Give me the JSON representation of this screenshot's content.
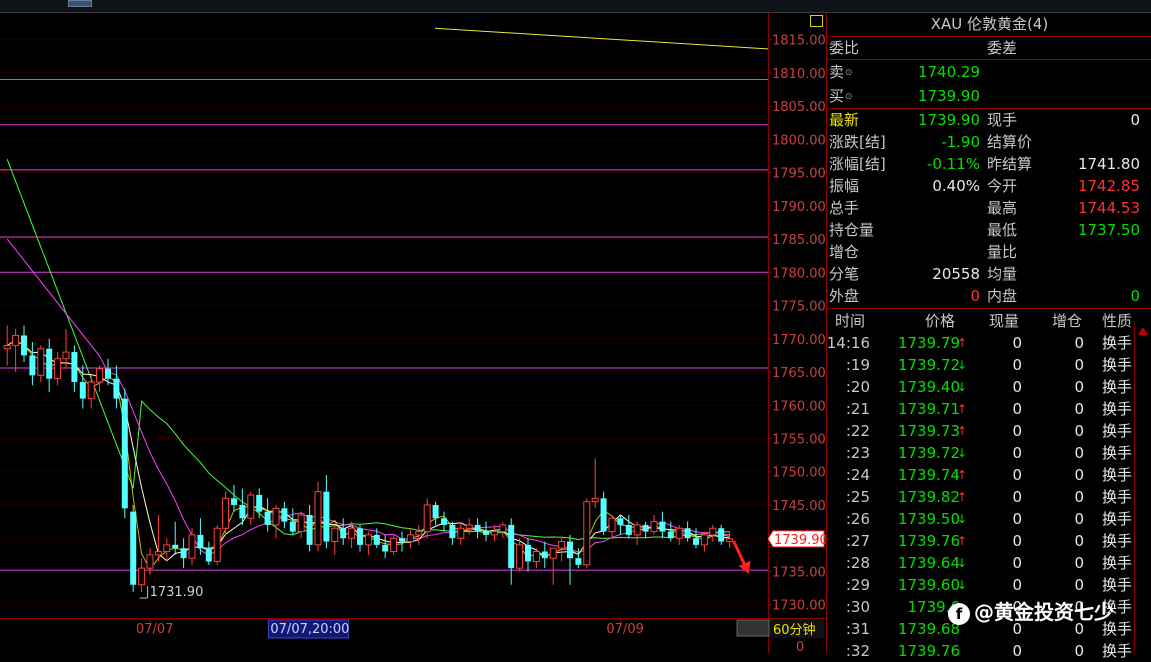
{
  "chart_data": {
    "type": "candlestick",
    "timeframe": "60分钟",
    "ylim": [
      1728.0,
      1819.0
    ],
    "y_ticks": [
      1815,
      1810,
      1805,
      1800,
      1795,
      1790,
      1785,
      1780,
      1775,
      1770,
      1765,
      1760,
      1755,
      1750,
      1745,
      1740,
      1735,
      1730
    ],
    "y_tick_labels": [
      "1815.00",
      "1810.00",
      "1805.00",
      "1800.00",
      "1795.00",
      "1790.00",
      "1785.00",
      "1780.00",
      "1775.00",
      "1770.00",
      "1765.00",
      "1760.00",
      "1755.00",
      "1750.00",
      "1745.00",
      "1740.00",
      "1735.00",
      "1730.00"
    ],
    "x_labels": [
      {
        "text": "07/07",
        "index": 17
      },
      {
        "text": "07/07,20:00",
        "index": 33,
        "highlight": true
      },
      {
        "text": "07/09",
        "index": 73
      }
    ],
    "last_price_label": "1739.90",
    "low_annotation": {
      "text": "1731.90",
      "index": 16,
      "value": 1731.9
    },
    "horizontal_levels": [
      1809.0,
      1802.2,
      1795.4,
      1785.3,
      1780.0,
      1765.6,
      1735.2
    ],
    "candles": [
      [
        1768.5,
        1772.0,
        1766.0,
        1769.0
      ],
      [
        1769.0,
        1771.5,
        1765.0,
        1770.5
      ],
      [
        1770.5,
        1772.0,
        1766.5,
        1767.5
      ],
      [
        1767.5,
        1769.5,
        1763.0,
        1764.5
      ],
      [
        1764.5,
        1769.0,
        1763.5,
        1768.5
      ],
      [
        1768.5,
        1770.0,
        1762.0,
        1764.0
      ],
      [
        1764.0,
        1768.0,
        1763.0,
        1767.0
      ],
      [
        1767.0,
        1771.5,
        1765.5,
        1768.0
      ],
      [
        1768.0,
        1769.0,
        1762.0,
        1763.5
      ],
      [
        1763.5,
        1766.0,
        1759.5,
        1761.0
      ],
      [
        1761.0,
        1764.5,
        1759.5,
        1763.5
      ],
      [
        1763.5,
        1766.0,
        1762.0,
        1765.5
      ],
      [
        1765.5,
        1767.0,
        1763.0,
        1764.0
      ],
      [
        1764.0,
        1766.0,
        1759.5,
        1761.0
      ],
      [
        1761.0,
        1762.5,
        1743.0,
        1744.5
      ],
      [
        1744.0,
        1745.0,
        1731.9,
        1733.0
      ],
      [
        1733.0,
        1737.0,
        1731.9,
        1735.5
      ],
      [
        1735.5,
        1738.5,
        1734.5,
        1737.5
      ],
      [
        1737.5,
        1743.5,
        1736.5,
        1738.0
      ],
      [
        1738.0,
        1740.0,
        1736.5,
        1739.0
      ],
      [
        1739.0,
        1742.5,
        1737.5,
        1738.5
      ],
      [
        1738.5,
        1740.0,
        1735.5,
        1737.0
      ],
      [
        1737.0,
        1741.5,
        1736.0,
        1740.5
      ],
      [
        1740.5,
        1743.0,
        1737.5,
        1738.5
      ],
      [
        1738.5,
        1739.5,
        1736.0,
        1736.5
      ],
      [
        1736.5,
        1742.0,
        1736.0,
        1741.5
      ],
      [
        1741.5,
        1747.0,
        1740.5,
        1746.0
      ],
      [
        1746.0,
        1748.0,
        1744.0,
        1745.0
      ],
      [
        1745.0,
        1747.5,
        1742.0,
        1743.0
      ],
      [
        1743.0,
        1747.0,
        1742.0,
        1746.5
      ],
      [
        1746.5,
        1747.5,
        1743.0,
        1744.0
      ],
      [
        1744.0,
        1746.0,
        1741.0,
        1742.0
      ],
      [
        1742.0,
        1745.0,
        1740.0,
        1744.5
      ],
      [
        1744.5,
        1745.5,
        1741.5,
        1742.5
      ],
      [
        1742.5,
        1744.5,
        1740.5,
        1741.0
      ],
      [
        1741.0,
        1744.0,
        1740.0,
        1743.5
      ],
      [
        1743.5,
        1745.0,
        1738.0,
        1739.0
      ],
      [
        1739.0,
        1748.5,
        1738.0,
        1747.0
      ],
      [
        1747.0,
        1749.5,
        1738.5,
        1739.5
      ],
      [
        1739.5,
        1742.0,
        1737.5,
        1741.5
      ],
      [
        1741.5,
        1743.0,
        1739.0,
        1740.0
      ],
      [
        1740.0,
        1742.5,
        1738.5,
        1741.5
      ],
      [
        1741.5,
        1742.0,
        1738.0,
        1739.0
      ],
      [
        1739.0,
        1741.0,
        1737.5,
        1740.5
      ],
      [
        1740.5,
        1741.5,
        1738.5,
        1739.0
      ],
      [
        1739.0,
        1740.5,
        1737.0,
        1738.0
      ],
      [
        1738.0,
        1740.5,
        1737.5,
        1740.0
      ],
      [
        1740.0,
        1741.0,
        1738.0,
        1739.5
      ],
      [
        1739.5,
        1741.5,
        1738.5,
        1740.5
      ],
      [
        1740.5,
        1742.0,
        1739.0,
        1741.0
      ],
      [
        1741.0,
        1746.0,
        1740.0,
        1745.0
      ],
      [
        1745.0,
        1745.5,
        1742.0,
        1743.0
      ],
      [
        1743.0,
        1744.0,
        1741.0,
        1742.0
      ],
      [
        1742.0,
        1742.5,
        1739.0,
        1740.0
      ],
      [
        1740.0,
        1742.5,
        1739.0,
        1741.5
      ],
      [
        1741.5,
        1743.0,
        1740.5,
        1742.0
      ],
      [
        1742.0,
        1743.0,
        1740.0,
        1741.0
      ],
      [
        1741.0,
        1742.5,
        1739.5,
        1740.5
      ],
      [
        1740.5,
        1742.0,
        1739.5,
        1741.0
      ],
      [
        1741.0,
        1742.5,
        1740.0,
        1742.0
      ],
      [
        1742.0,
        1743.0,
        1733.0,
        1735.5
      ],
      [
        1735.5,
        1740.0,
        1735.0,
        1739.0
      ],
      [
        1739.0,
        1740.0,
        1735.0,
        1736.5
      ],
      [
        1736.5,
        1738.5,
        1735.5,
        1738.0
      ],
      [
        1738.0,
        1739.5,
        1735.5,
        1737.0
      ],
      [
        1737.0,
        1738.0,
        1733.0,
        1738.5
      ],
      [
        1738.5,
        1740.0,
        1736.5,
        1739.5
      ],
      [
        1739.5,
        1740.5,
        1733.0,
        1737.0
      ],
      [
        1737.0,
        1738.5,
        1735.5,
        1736.0
      ],
      [
        1736.0,
        1746.0,
        1735.5,
        1745.5
      ],
      [
        1745.5,
        1752.0,
        1744.5,
        1746.0
      ],
      [
        1746.0,
        1747.0,
        1740.5,
        1741.0
      ],
      [
        1741.0,
        1743.5,
        1740.0,
        1743.0
      ],
      [
        1743.0,
        1743.5,
        1740.5,
        1742.0
      ],
      [
        1742.0,
        1743.5,
        1740.0,
        1740.5
      ],
      [
        1740.5,
        1742.5,
        1739.0,
        1742.0
      ],
      [
        1742.0,
        1742.5,
        1740.0,
        1741.0
      ],
      [
        1741.0,
        1743.5,
        1740.5,
        1742.5
      ],
      [
        1742.5,
        1744.0,
        1740.0,
        1741.0
      ],
      [
        1741.0,
        1742.5,
        1739.5,
        1740.0
      ],
      [
        1740.0,
        1742.0,
        1739.0,
        1741.5
      ],
      [
        1741.5,
        1742.5,
        1739.5,
        1740.0
      ],
      [
        1740.0,
        1741.5,
        1738.5,
        1739.0
      ],
      [
        1739.0,
        1741.0,
        1738.0,
        1740.5
      ],
      [
        1740.5,
        1742.0,
        1739.5,
        1741.5
      ],
      [
        1741.5,
        1742.0,
        1739.0,
        1739.5
      ],
      [
        1739.5,
        1741.0,
        1738.5,
        1739.9
      ]
    ],
    "ma_colors": [
      "#ffffe0",
      "#ff40ff",
      "#40ff40",
      "#f0f000"
    ],
    "up_color": "#ff4040",
    "down_color": "#54ffff"
  },
  "quote": {
    "title": "XAU 伦敦黄金(4)",
    "weibi_label": "委比",
    "weicha_label": "委差",
    "sell_label": "卖",
    "sell_price": "1740.29",
    "buy_label": "买",
    "buy_price": "1739.90",
    "latest_label": "最新",
    "latest_value": "1739.90",
    "xianshou_label": "现手",
    "xianshou_value": "0",
    "change_label": "涨跌[结]",
    "change_value": "-1.90",
    "settle_label": "结算价",
    "settle_value": "",
    "pct_label": "涨幅[结]",
    "pct_value": "-0.11%",
    "prev_settle_label": "昨结算",
    "prev_settle_value": "1741.80",
    "amp_label": "振幅",
    "amp_value": "0.40%",
    "open_label": "今开",
    "open_value": "1742.85",
    "vol_label": "总手",
    "vol_value": "",
    "high_label": "最高",
    "high_value": "1744.53",
    "oi_label": "持仓量",
    "oi_value": "",
    "low_label": "最低",
    "low_value": "1737.50",
    "oichg_label": "增仓",
    "oichg_value": "",
    "ratio_label": "量比",
    "ratio_value": "",
    "ticks_label": "分笔",
    "ticks_value": "20558",
    "avg_label": "均量",
    "avg_value": "",
    "outer_label": "外盘",
    "outer_value": "0",
    "inner_label": "内盘",
    "inner_value": "0"
  },
  "trades": {
    "headers": [
      "时间",
      "价格",
      "现量",
      "增仓",
      "性质"
    ],
    "rows": [
      {
        "time": "14:16",
        "price": "1739.79",
        "dir": "↑",
        "qty": "0",
        "oi": "0",
        "nature": "换手"
      },
      {
        "time": ":19",
        "price": "1739.72",
        "dir": "↓",
        "qty": "0",
        "oi": "0",
        "nature": "换手"
      },
      {
        "time": ":20",
        "price": "1739.40",
        "dir": "↓",
        "qty": "0",
        "oi": "0",
        "nature": "换手"
      },
      {
        "time": ":21",
        "price": "1739.71",
        "dir": "↑",
        "qty": "0",
        "oi": "0",
        "nature": "换手"
      },
      {
        "time": ":22",
        "price": "1739.73",
        "dir": "↑",
        "qty": "0",
        "oi": "0",
        "nature": "换手"
      },
      {
        "time": ":23",
        "price": "1739.72",
        "dir": "↓",
        "qty": "0",
        "oi": "0",
        "nature": "换手"
      },
      {
        "time": ":24",
        "price": "1739.74",
        "dir": "↑",
        "qty": "0",
        "oi": "0",
        "nature": "换手"
      },
      {
        "time": ":25",
        "price": "1739.82",
        "dir": "↑",
        "qty": "0",
        "oi": "0",
        "nature": "换手"
      },
      {
        "time": ":26",
        "price": "1739.50",
        "dir": "↓",
        "qty": "0",
        "oi": "0",
        "nature": "换手"
      },
      {
        "time": ":27",
        "price": "1739.76",
        "dir": "↑",
        "qty": "0",
        "oi": "0",
        "nature": "换手"
      },
      {
        "time": ":28",
        "price": "1739.64",
        "dir": "↓",
        "qty": "0",
        "oi": "0",
        "nature": "换手"
      },
      {
        "time": ":29",
        "price": "1739.60",
        "dir": "↓",
        "qty": "0",
        "oi": "0",
        "nature": "换手"
      },
      {
        "time": ":30",
        "price": "1739.6",
        "dir": "",
        "qty": "0",
        "oi": "0",
        "nature": "换手"
      },
      {
        "time": ":31",
        "price": "1739.68",
        "dir": "",
        "qty": "0",
        "oi": "0",
        "nature": "换手"
      },
      {
        "time": ":32",
        "price": "1739.76",
        "dir": "",
        "qty": "0",
        "oi": "0",
        "nature": "换手"
      }
    ]
  },
  "watermark": {
    "icon": "f",
    "text": "@黄金投资七少"
  },
  "bottom_zero": "0"
}
